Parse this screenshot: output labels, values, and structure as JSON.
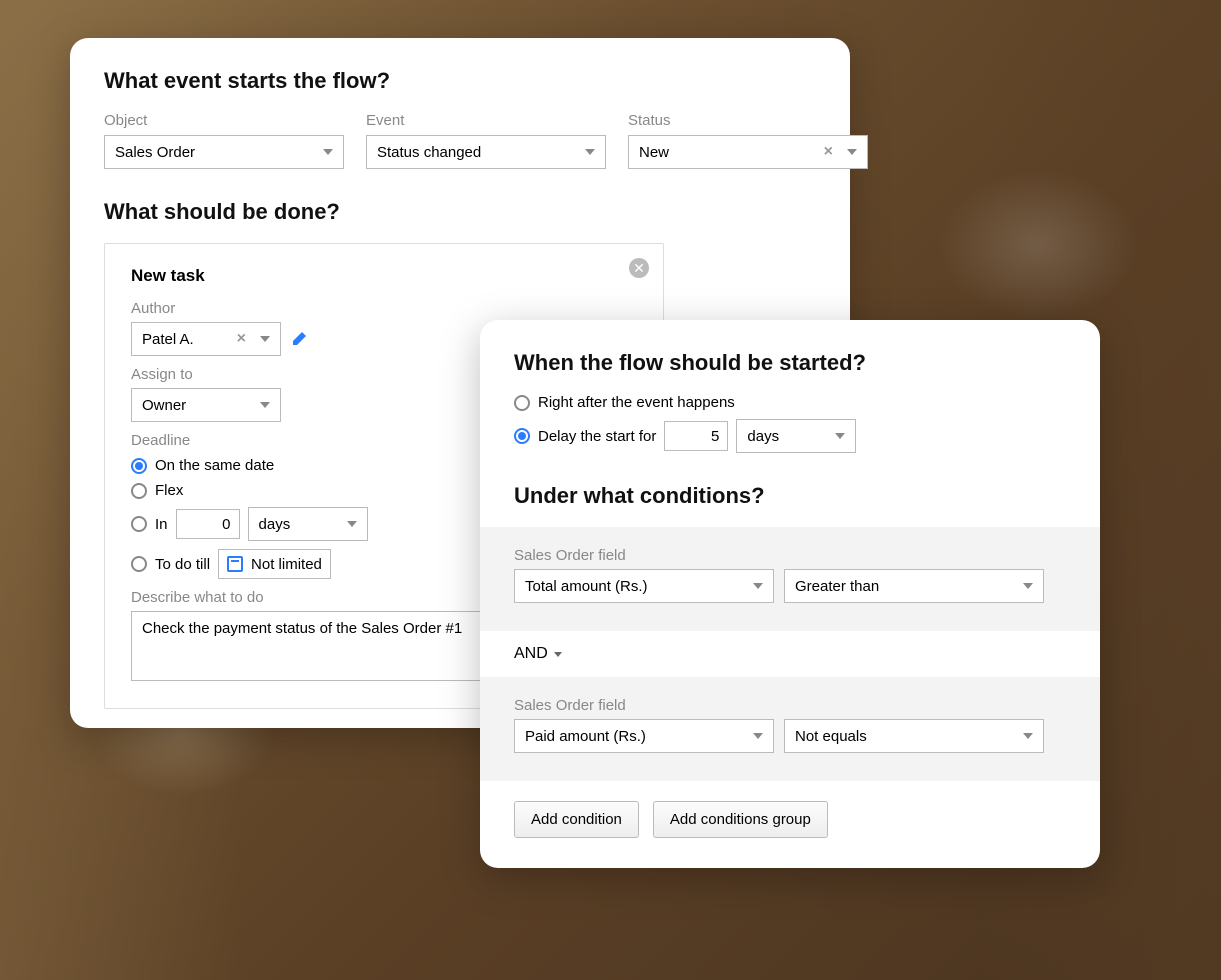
{
  "card1": {
    "heading_event": "What event starts the flow?",
    "object_label": "Object",
    "object_value": "Sales Order",
    "event_label": "Event",
    "event_value": "Status changed",
    "status_label": "Status",
    "status_value": "New",
    "heading_action": "What should be done?",
    "task": {
      "title": "New task",
      "author_label": "Author",
      "author_value": "Patel A.",
      "assign_label": "Assign to",
      "assign_value": "Owner",
      "deadline_label": "Deadline",
      "deadline_same": "On the same date",
      "deadline_flex": "Flex",
      "deadline_in": "In",
      "deadline_in_value": "0",
      "deadline_in_unit": "days",
      "deadline_till": "To do till",
      "deadline_till_value": "Not limited",
      "describe_label": "Describe what to do",
      "describe_value": "Check the payment status of the Sales Order #1"
    }
  },
  "card2": {
    "heading_when": "When the flow should be started?",
    "opt_right_after": "Right after the event happens",
    "opt_delay": "Delay the start for",
    "delay_value": "5",
    "delay_unit": "days",
    "heading_conditions": "Under what conditions?",
    "cond_field_label": "Sales Order field",
    "cond1_field": "Total amount (Rs.)",
    "cond1_op": "Greater than",
    "and_label": "AND",
    "cond2_field": "Paid amount (Rs.)",
    "cond2_op": "Not equals",
    "btn_add_condition": "Add condition",
    "btn_add_group": "Add conditions group"
  }
}
